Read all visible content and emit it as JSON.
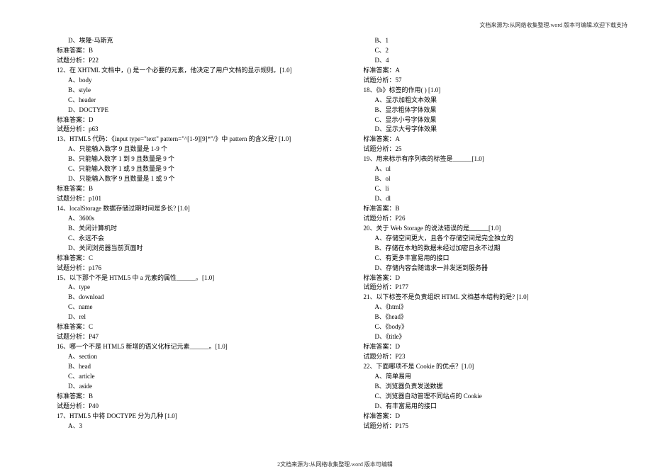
{
  "header": "文档来源为:从网络收集整理.word 版本可编辑.欢迎下载支持",
  "footer": "2文档来源为:从网络收集整理.word 版本可编辑",
  "left": {
    "q11_optD": "D、埃隆·马斯克",
    "q11_ans": "标准答案：B",
    "q11_anal": "试题分析：P22",
    "q12_stem": "12、在 XHTML 文档中，() 是一个必要的元素，他决定了用户文档的显示规则。[1.0]",
    "q12_A": "A、body",
    "q12_B": "B、style",
    "q12_C": "C、header",
    "q12_D": "D、DOCTYPE",
    "q12_ans": "标准答案：D",
    "q12_anal": "试题分析：p63",
    "q13_stem": "13、HTML5 代码：《input type=\"text\" pattern=\"^[1-9][9]*\"/》中 pattern 的含义是? [1.0]",
    "q13_A": "A、只能输入数字 9 且数量是 1-9 个",
    "q13_B": "B、只能输入数字 1 到 9 且数量是 9 个",
    "q13_C": "C、只能输入数字 1 或 9 且数量是 9 个",
    "q13_D": "D、只能输入数字 9 且数量是 1 或 9 个",
    "q13_ans": "标准答案：B",
    "q13_anal": "试题分析：p101",
    "q14_stem": "14、localStorage 数据存储过期时间是多长? [1.0]",
    "q14_A": "A、3600s",
    "q14_B": "B、关闭计算机时",
    "q14_C": "C、永远不会",
    "q14_D": "D、关闭浏览器当前页面时",
    "q14_ans": "标准答案：C",
    "q14_anal": "试题分析：p176",
    "q15_stem": "15、以下那个不是 HTML5 中 a 元素的属性______。[1.0]",
    "q15_A": "A、type",
    "q15_B": "B、download",
    "q15_C": "C、name",
    "q15_D": "D、rel",
    "q15_ans": "标准答案：C",
    "q15_anal": "试题分析：P47",
    "q16_stem": "16、哪一个不是 HTML5 新增的语义化标记元素______。[1.0]",
    "q16_A": "A、section",
    "q16_B": "B、head",
    "q16_C": "C、article",
    "q16_D": "D、aside",
    "q16_ans": "标准答案：B",
    "q16_anal": "试题分析：P40",
    "q17_stem": "17、HTML5 中将 DOCTYPE 分为几种 [1.0]",
    "q17_A": "A、3"
  },
  "right": {
    "q17_B": "B、1",
    "q17_C": "C、2",
    "q17_D": "D、4",
    "q17_ans": "标准答案：A",
    "q17_anal": "试题分析：57",
    "q18_stem": "18、《b》标签的作用(  ) [1.0]",
    "q18_A": "A、显示加粗文本效果",
    "q18_B": "B、显示粗体字体效果",
    "q18_C": "C、显示小号字体效果",
    "q18_D": "D、显示大号字体效果",
    "q18_ans": "标准答案：A",
    "q18_anal": "试题分析：25",
    "q19_stem": "19、用来标示有序列表的标签是______[1.0]",
    "q19_A": "A、ul",
    "q19_B": "B、ol",
    "q19_C": "C、li",
    "q19_D": "D、dl",
    "q19_ans": "标准答案：B",
    "q19_anal": "试题分析：P26",
    "q20_stem": "20、关于 Web Storage 的说法错误的是______[1.0]",
    "q20_A": "A、存储空间更大，且各个存储空间是完全独立的",
    "q20_B": "B、存储在本地的数据未经过加密且永不过期",
    "q20_C": "C、有更多丰富易用的接口",
    "q20_D": "D、存储内容会随请求一并发送到服务器",
    "q20_ans": "标准答案：D",
    "q20_anal": "试题分析：P177",
    "q21_stem": "21、以下标签不是负责组织 HTML 文档基本结构的是? [1.0]",
    "q21_A": "A、《html》",
    "q21_B": "B、《head》",
    "q21_C": "C、《body》",
    "q21_D": "D、《title》",
    "q21_ans": "标准答案：D",
    "q21_anal": "试题分析：P23",
    "q22_stem": "22、下面哪项不是 Cookie 的优点？[1.0]",
    "q22_A": "A、简单易用",
    "q22_B": "B、浏览器负责发送数据",
    "q22_C": "C、浏览器自动管理不同站点的 Cookie",
    "q22_D": "D、有丰富易用的接口",
    "q22_ans": "标准答案：D",
    "q22_anal": "试题分析：P175"
  }
}
